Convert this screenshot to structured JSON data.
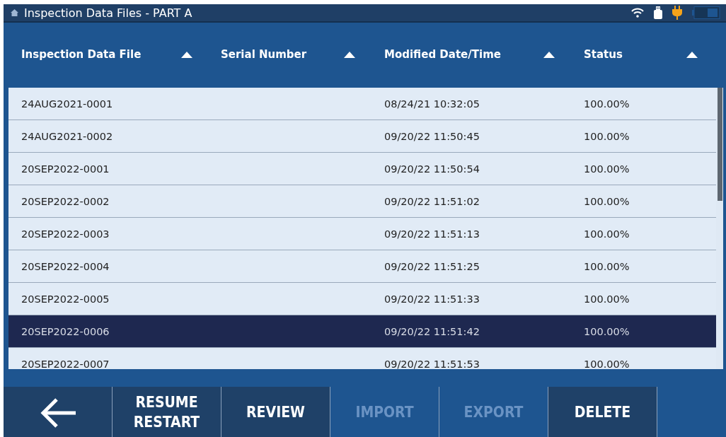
{
  "window": {
    "title": "Inspection Data Files - PART A"
  },
  "table": {
    "columns": [
      {
        "label": "Inspection Data File"
      },
      {
        "label": "Serial Number"
      },
      {
        "label": "Modified Date/Time"
      },
      {
        "label": "Status"
      }
    ],
    "rows": [
      {
        "file": "24AUG2021-0001",
        "modified": "08/24/21 10:32:05",
        "status": "100.00%",
        "selected": false
      },
      {
        "file": "24AUG2021-0002",
        "modified": "09/20/22 11:50:45",
        "status": "100.00%",
        "selected": false
      },
      {
        "file": "20SEP2022-0001",
        "modified": "09/20/22 11:50:54",
        "status": "100.00%",
        "selected": false
      },
      {
        "file": "20SEP2022-0002",
        "modified": "09/20/22 11:51:02",
        "status": "100.00%",
        "selected": false
      },
      {
        "file": "20SEP2022-0003",
        "modified": "09/20/22 11:51:13",
        "status": "100.00%",
        "selected": false
      },
      {
        "file": "20SEP2022-0004",
        "modified": "09/20/22 11:51:25",
        "status": "100.00%",
        "selected": false
      },
      {
        "file": "20SEP2022-0005",
        "modified": "09/20/22 11:51:33",
        "status": "100.00%",
        "selected": false
      },
      {
        "file": "20SEP2022-0006",
        "modified": "09/20/22 11:51:42",
        "status": "100.00%",
        "selected": true
      },
      {
        "file": "20SEP2022-0007",
        "modified": "09/20/22 11:51:53",
        "status": "100.00%",
        "selected": false
      }
    ]
  },
  "toolbar": [
    {
      "kind": "back",
      "disabled": false
    },
    {
      "kind": "text",
      "label": "RESUME RESTART",
      "disabled": false
    },
    {
      "kind": "text",
      "label": "REVIEW",
      "disabled": false
    },
    {
      "kind": "text",
      "label": "IMPORT",
      "disabled": true
    },
    {
      "kind": "text",
      "label": "EXPORT",
      "disabled": true
    },
    {
      "kind": "text",
      "label": "DELETE",
      "disabled": false
    }
  ]
}
